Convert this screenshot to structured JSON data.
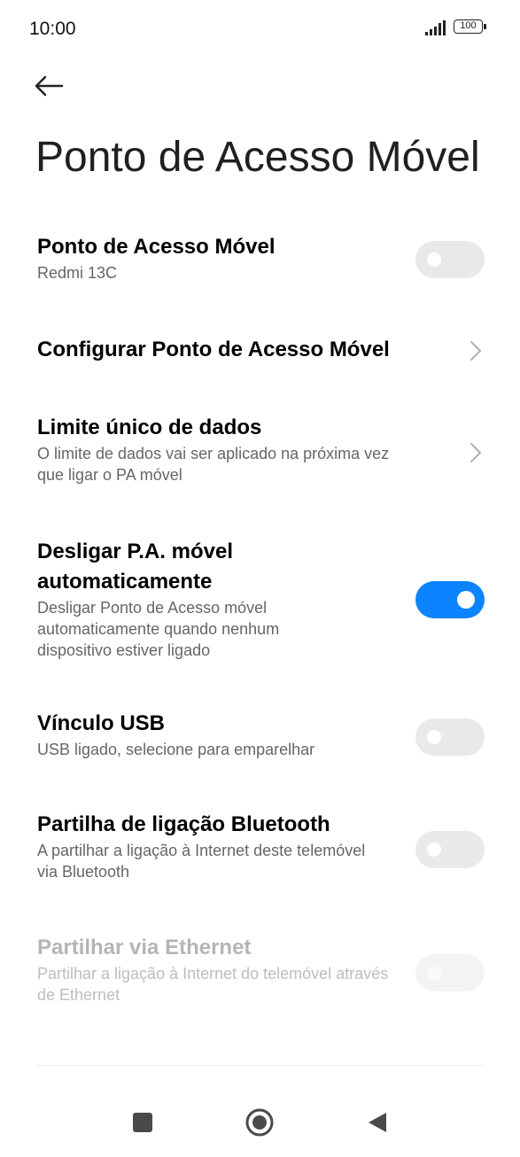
{
  "status_bar": {
    "time": "10:00",
    "battery": "100"
  },
  "header": {
    "title": "Ponto de Acesso Móvel"
  },
  "rows": [
    {
      "title": "Ponto de Acesso Móvel",
      "subtitle": "Redmi 13C",
      "control": "toggle",
      "state": "off"
    },
    {
      "title": "Configurar Ponto de Acesso Móvel",
      "control": "chevron"
    },
    {
      "title": "Limite único de dados",
      "subtitle": "O limite de dados vai ser aplicado na próxima vez que ligar o PA móvel",
      "control": "chevron"
    },
    {
      "title": "Desligar P.A. móvel automaticamente",
      "subtitle": "Desligar Ponto de Acesso móvel automaticamente quando nenhum dispositivo estiver ligado",
      "control": "toggle",
      "state": "on"
    },
    {
      "title": "Vínculo USB",
      "subtitle": "USB ligado, selecione para emparelhar",
      "control": "toggle",
      "state": "off"
    },
    {
      "title": "Partilha de ligação Bluetooth",
      "subtitle": "A partilhar a ligação à Internet deste telemóvel via Bluetooth",
      "control": "toggle",
      "state": "off"
    },
    {
      "title": "Partilhar via Ethernet",
      "subtitle": "Partilhar a ligação à Internet do telemóvel através de Ethernet",
      "control": "toggle",
      "state": "off",
      "disabled": true
    }
  ],
  "colors": {
    "accent": "#0d84ff",
    "toggle_off": "#e9e9e9",
    "subtitle": "#666666",
    "disabled_text": "#b5b5b5"
  },
  "icons": {
    "back": "arrow-left-icon",
    "chevron": "chevron-right-icon",
    "nav_recents": "square-icon",
    "nav_home": "circle-icon",
    "nav_back": "triangle-left-icon"
  }
}
